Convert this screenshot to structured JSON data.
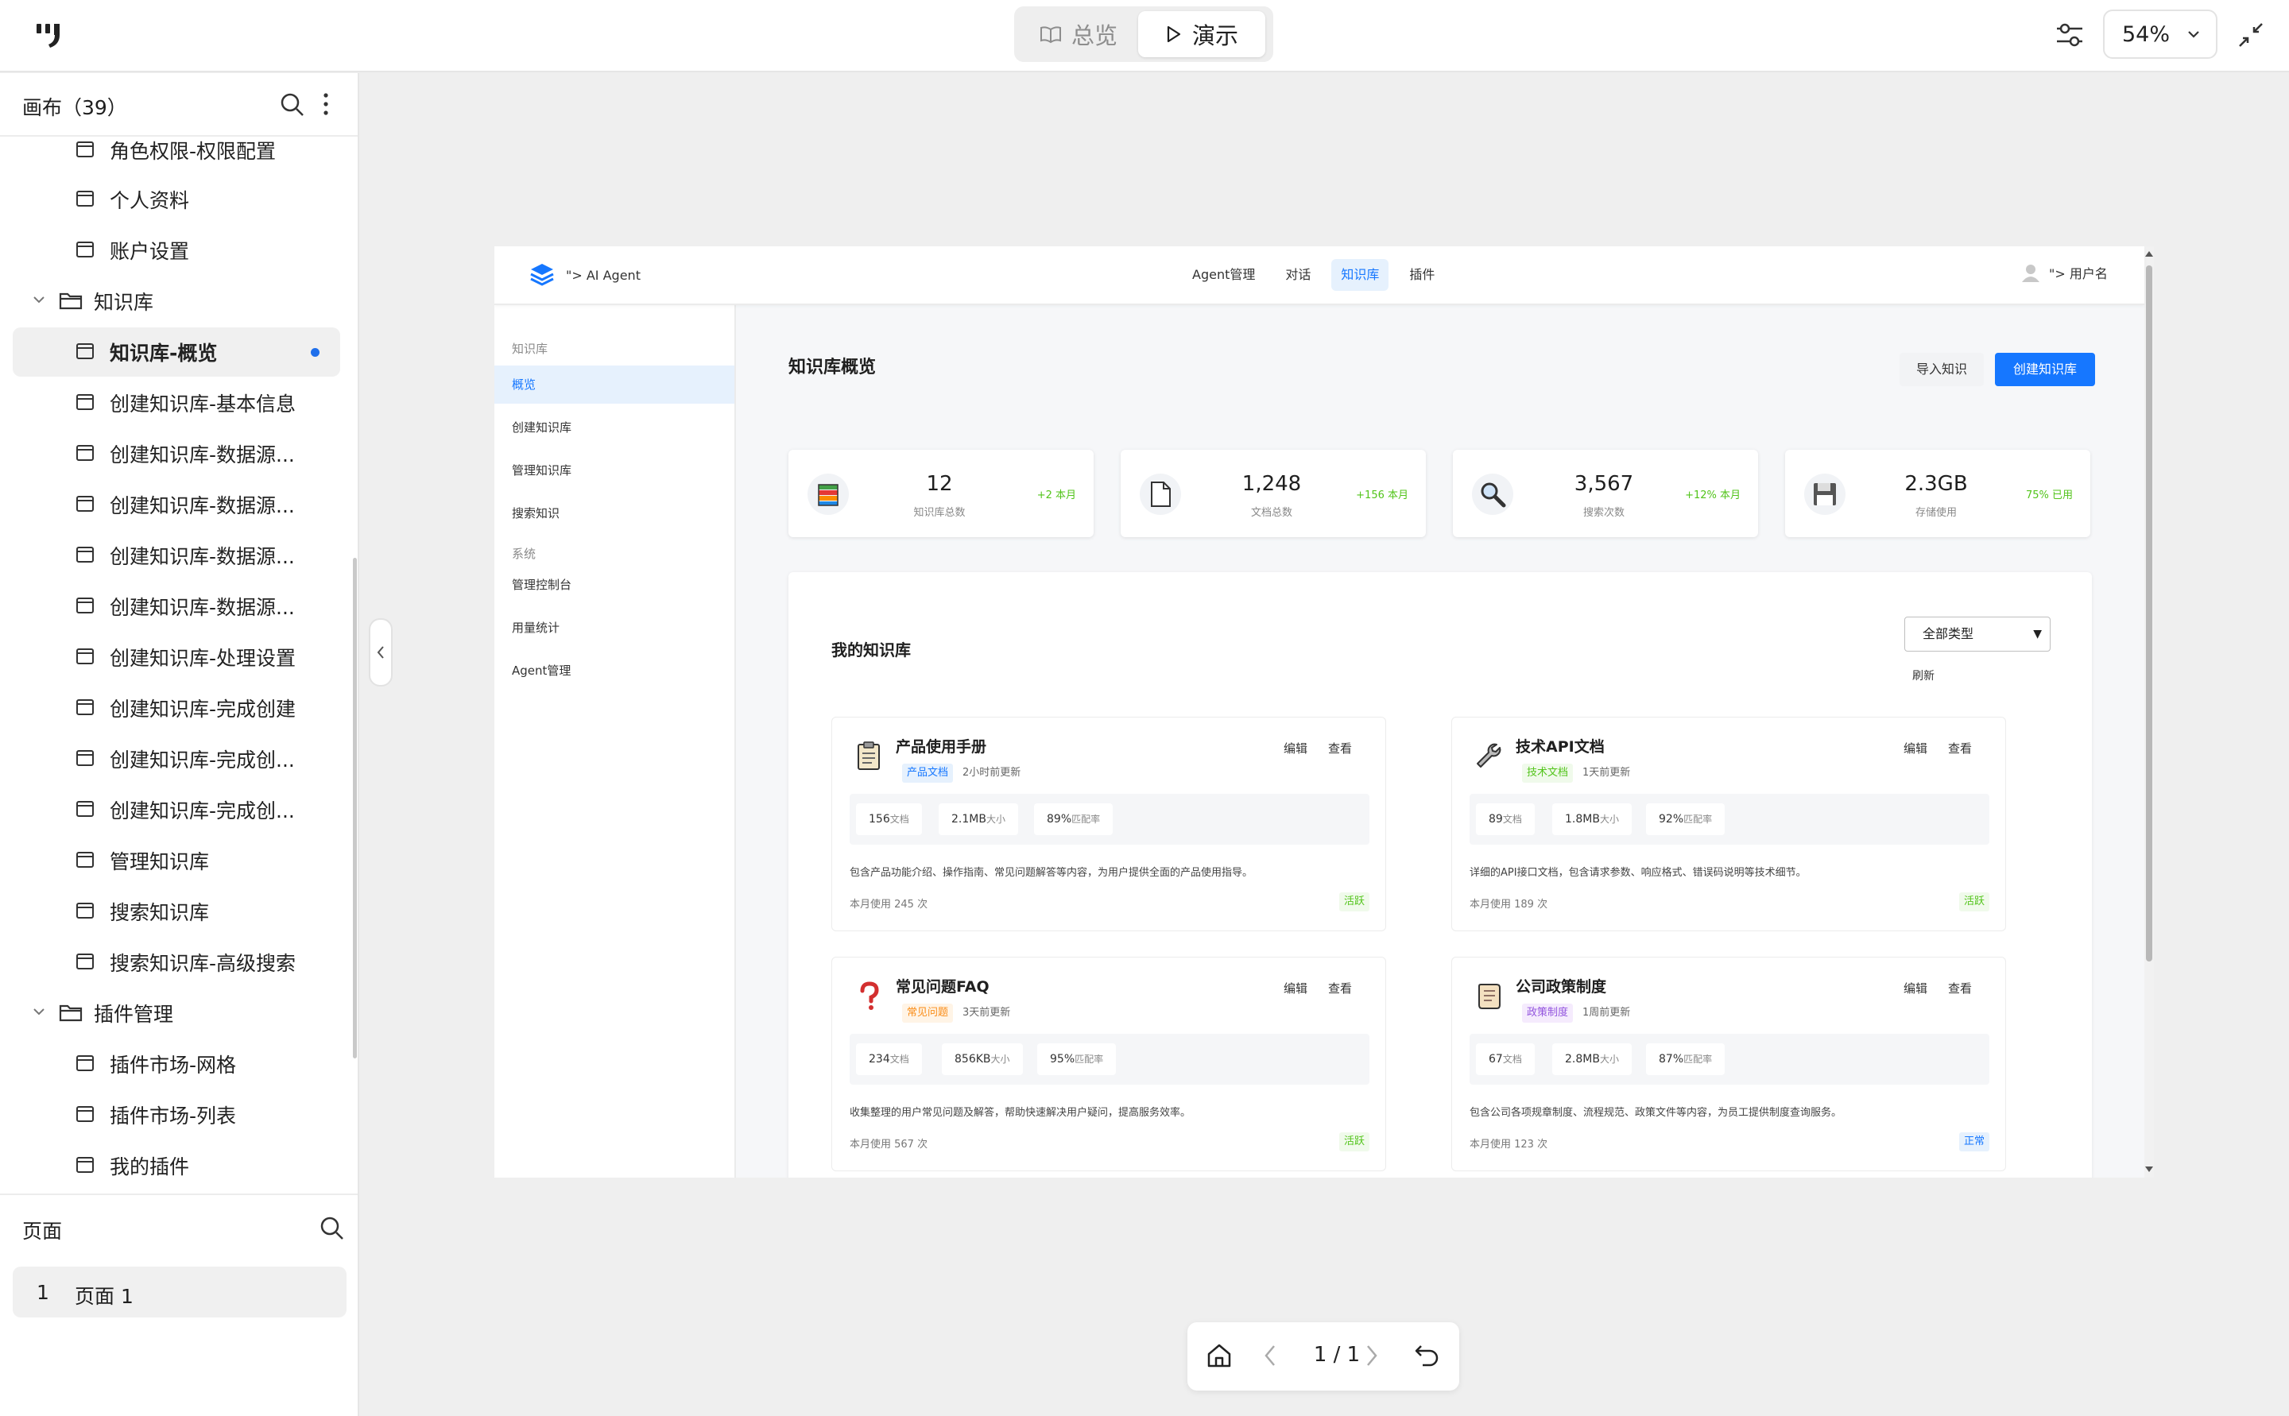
{
  "topbar": {
    "overview_label": "总览",
    "present_label": "演示",
    "zoom": "54%"
  },
  "sidebar": {
    "canvas_title": "画布（39）",
    "items": [
      {
        "label": "角色权限-权限配置",
        "type": "page"
      },
      {
        "label": "个人资料",
        "type": "page"
      },
      {
        "label": "账户设置",
        "type": "page"
      },
      {
        "label": "知识库",
        "type": "folder"
      },
      {
        "label": "知识库-概览",
        "type": "page",
        "selected": true
      },
      {
        "label": "创建知识库-基本信息",
        "type": "page"
      },
      {
        "label": "创建知识库-数据源...",
        "type": "page"
      },
      {
        "label": "创建知识库-数据源...",
        "type": "page"
      },
      {
        "label": "创建知识库-数据源...",
        "type": "page"
      },
      {
        "label": "创建知识库-数据源...",
        "type": "page"
      },
      {
        "label": "创建知识库-处理设置",
        "type": "page"
      },
      {
        "label": "创建知识库-完成创建",
        "type": "page"
      },
      {
        "label": "创建知识库-完成创...",
        "type": "page"
      },
      {
        "label": "创建知识库-完成创...",
        "type": "page"
      },
      {
        "label": "管理知识库",
        "type": "page"
      },
      {
        "label": "搜索知识库",
        "type": "page"
      },
      {
        "label": "搜索知识库-高级搜索",
        "type": "page"
      },
      {
        "label": "插件管理",
        "type": "folder"
      },
      {
        "label": "插件市场-网格",
        "type": "page"
      },
      {
        "label": "插件市场-列表",
        "type": "page"
      },
      {
        "label": "我的插件",
        "type": "page"
      }
    ],
    "pages_title": "页面",
    "pages": [
      {
        "num": "1",
        "name": "页面 1"
      }
    ]
  },
  "preview": {
    "brand": "\"> AI Agent",
    "nav": [
      "Agent管理",
      "对话",
      "知识库",
      "插件"
    ],
    "nav_active": 2,
    "user": "\"> 用户名",
    "side": {
      "section1": "知识库",
      "items1": [
        "概览",
        "创建知识库",
        "管理知识库",
        "搜索知识"
      ],
      "section2": "系统",
      "items2": [
        "管理控制台",
        "用量统计",
        "Agent管理"
      ]
    },
    "page_title": "知识库概览",
    "import_label": "导入知识",
    "create_label": "创建知识库",
    "stats": [
      {
        "value": "12",
        "label": "知识库总数",
        "trend": "+2 本月",
        "icon": "books-icon"
      },
      {
        "value": "1,248",
        "label": "文档总数",
        "trend": "+156 本月",
        "icon": "document-icon"
      },
      {
        "value": "3,567",
        "label": "搜索次数",
        "trend": "+12% 本月",
        "icon": "magnifier-icon"
      },
      {
        "value": "2.3GB",
        "label": "存储使用",
        "trend": "75% 已用",
        "icon": "floppy-disk-icon"
      }
    ],
    "kb_title": "我的知识库",
    "filter_value": "全部类型",
    "refresh_label": "刷新",
    "edit_label": "编辑",
    "view_label": "查看",
    "cards": [
      {
        "name": "产品使用手册",
        "tag": "产品文档",
        "updated": "2小时前更新",
        "docs": "156",
        "docs_unit": "文档",
        "size": "2.1MB",
        "size_unit": "大小",
        "match": "89%",
        "match_unit": "匹配率",
        "desc": "包含产品功能介绍、操作指南、常见问题解答等内容，为用户提供全面的产品使用指导。",
        "usage": "本月使用 245 次",
        "status": "活跃",
        "icon": "clipboard-icon"
      },
      {
        "name": "技术API文档",
        "tag": "技术文档",
        "updated": "1天前更新",
        "docs": "89",
        "docs_unit": "文档",
        "size": "1.8MB",
        "size_unit": "大小",
        "match": "92%",
        "match_unit": "匹配率",
        "desc": "详细的API接口文档，包含请求参数、响应格式、错误码说明等技术细节。",
        "usage": "本月使用 189 次",
        "status": "活跃",
        "icon": "wrench-icon"
      },
      {
        "name": "常见问题FAQ",
        "tag": "常见问题",
        "updated": "3天前更新",
        "docs": "234",
        "docs_unit": "文档",
        "size": "856KB",
        "size_unit": "大小",
        "match": "95%",
        "match_unit": "匹配率",
        "desc": "收集整理的用户常见问题及解答，帮助快速解决用户疑问，提高服务效率。",
        "usage": "本月使用 567 次",
        "status": "活跃",
        "icon": "question-mark-icon"
      },
      {
        "name": "公司政策制度",
        "tag": "政策制度",
        "updated": "1周前更新",
        "docs": "67",
        "docs_unit": "文档",
        "size": "2.8MB",
        "size_unit": "大小",
        "match": "87%",
        "match_unit": "匹配率",
        "desc": "包含公司各项规章制度、流程规范、政策文件等内容，为员工提供制度查询服务。",
        "usage": "本月使用 123 次",
        "status": "正常",
        "icon": "scroll-icon"
      }
    ]
  },
  "player": {
    "page_indicator": "1 / 1"
  }
}
